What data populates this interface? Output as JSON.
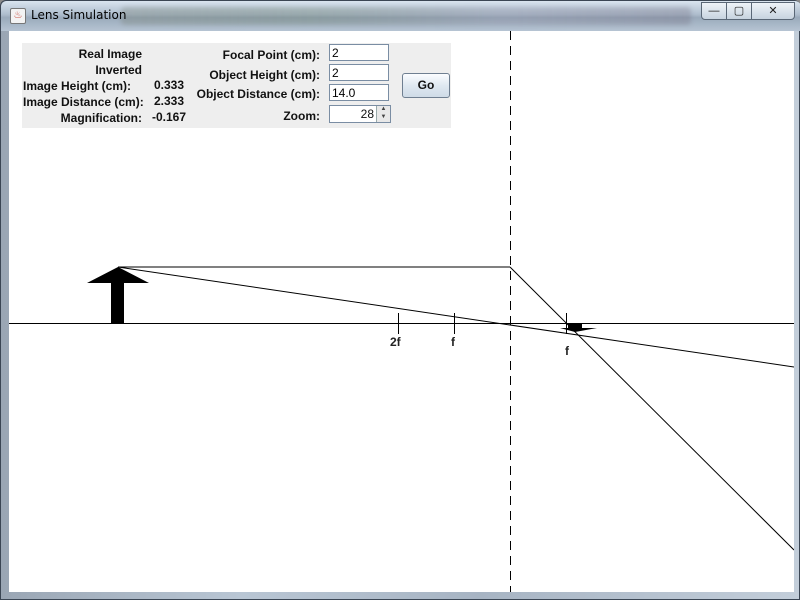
{
  "window": {
    "title": "Lens Simulation",
    "app_icon": "java-cup-icon",
    "controls": {
      "minimize": "—",
      "maximize": "▢",
      "close": "✕"
    }
  },
  "info": {
    "image_type": "Real Image",
    "orientation": "Inverted",
    "image_height_label": "Image Height (cm):",
    "image_height_value": "0.333",
    "image_distance_label": "Image Distance (cm):",
    "image_distance_value": "2.333",
    "magnification_label": "Magnification:",
    "magnification_value": "-0.167"
  },
  "controls": {
    "focal_point_label": "Focal Point (cm):",
    "focal_point_value": "2",
    "object_height_label": "Object Height (cm):",
    "object_height_value": "2",
    "object_distance_label": "Object Distance (cm):",
    "object_distance_value": "14.0",
    "zoom_label": "Zoom:",
    "zoom_value": "28",
    "go_label": "Go"
  },
  "scene": {
    "tick_2f_label": "2f",
    "tick_f_left_label": "f",
    "tick_f_right_label": "f",
    "line_color": "#000000"
  }
}
